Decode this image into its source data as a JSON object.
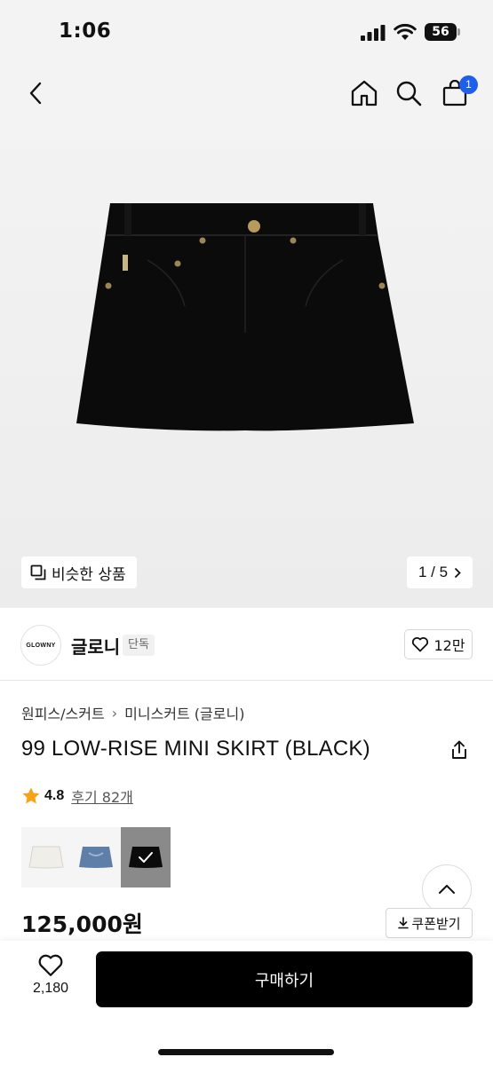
{
  "status_bar": {
    "time": "1:06",
    "battery": "56",
    "icons": [
      "signal-icon",
      "wifi-icon",
      "battery-icon"
    ]
  },
  "nav": {
    "icons": [
      "back-arrow-icon",
      "home-icon",
      "search-icon",
      "shopping-bag-icon"
    ],
    "cart_count": "1"
  },
  "gallery": {
    "similar_label": "비슷한 상품",
    "pager": "1 / 5",
    "product_color": "#0b0b0b"
  },
  "brand": {
    "logo_text": "GLOWNY",
    "name": "글로니",
    "tag": "단독",
    "likes": "12만"
  },
  "breadcrumb": [
    "원피스/스커트",
    "미니스커트 (글로니)"
  ],
  "product": {
    "title": "99 LOW-RISE MINI SKIRT (BLACK)",
    "rating": "4.8",
    "reviews": "후기 82개",
    "price": "125,000원",
    "colors": [
      {
        "name": "white",
        "swatch": "#efeee9"
      },
      {
        "name": "denim",
        "swatch": "#5f7fa8"
      },
      {
        "name": "black",
        "swatch": "#0b0b0b",
        "selected": true
      }
    ]
  },
  "actions": {
    "coupon_label": "쿠폰받기",
    "wish_count": "2,180",
    "buy_label": "구매하기"
  },
  "colors": {
    "accent_blue": "#1e5eea",
    "star": "#f7a21b",
    "buy_button": "#000000"
  }
}
